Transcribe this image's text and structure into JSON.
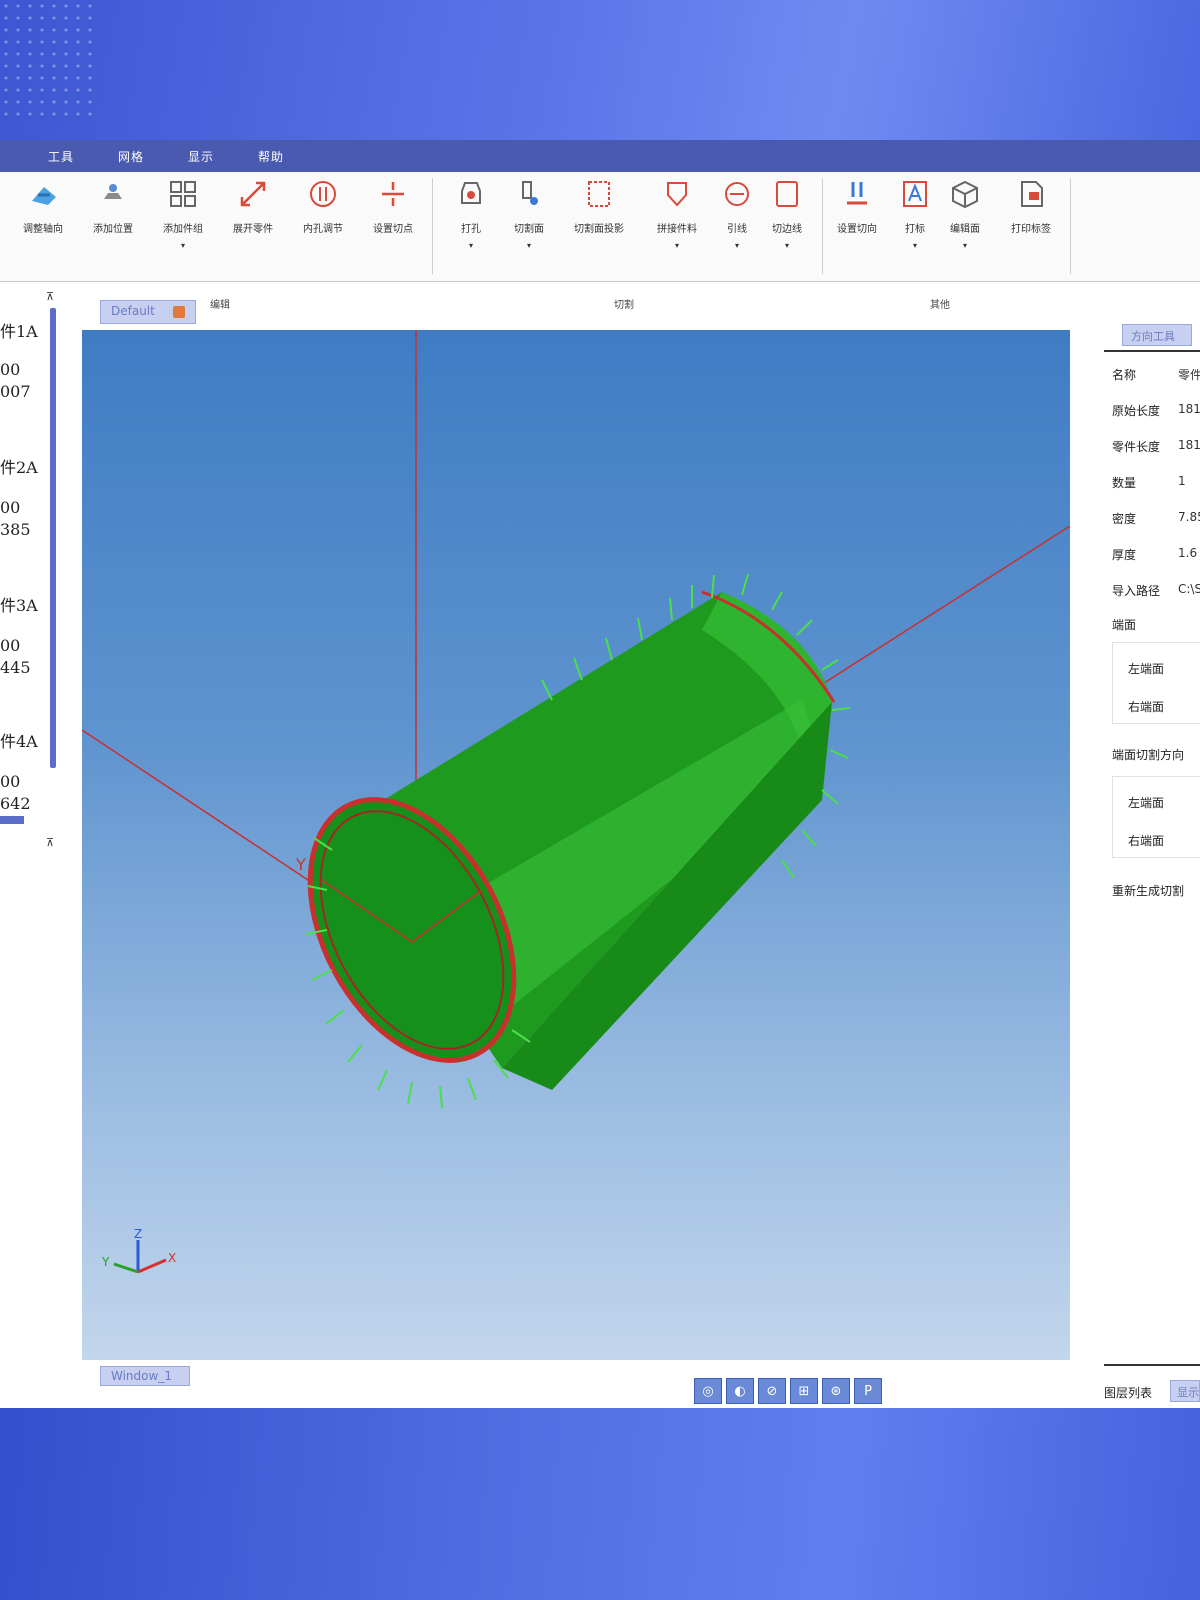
{
  "colors": {
    "menubar": "#4a5ab0",
    "accent": "#5b6dc9",
    "viewport_top": "#3f7cc4",
    "viewport_bottom": "#c2d6ec",
    "model_green": "#1e9a1e",
    "edge_red": "#d12a2a"
  },
  "menu": {
    "items": [
      "工具",
      "网格",
      "显示",
      "帮助"
    ]
  },
  "ribbon": {
    "tools": [
      {
        "label": "调整轴向",
        "icon": "axis-arrow-icon"
      },
      {
        "label": "添加位置",
        "icon": "position-icon"
      },
      {
        "label": "添加件组",
        "icon": "grid-icon"
      },
      {
        "label": "展开零件",
        "icon": "expand-icon"
      },
      {
        "label": "内孔调节",
        "icon": "hole-adjust-icon"
      },
      {
        "label": "设置切点",
        "icon": "cut-point-icon"
      },
      {
        "label": "打孔",
        "icon": "drill-icon"
      },
      {
        "label": "切割面",
        "icon": "cut-face-icon"
      },
      {
        "label": "切割面投影",
        "icon": "projection-icon"
      },
      {
        "label": "拼接件料",
        "icon": "joint-icon"
      },
      {
        "label": "引线",
        "icon": "lead-icon"
      },
      {
        "label": "切边线",
        "icon": "edge-icon"
      },
      {
        "label": "设置切向",
        "icon": "cut-direction-icon"
      },
      {
        "label": "打标",
        "icon": "mark-icon"
      },
      {
        "label": "编辑面",
        "icon": "cube-icon"
      },
      {
        "label": "打印标签",
        "icon": "print-label-icon"
      }
    ],
    "groups": [
      "编辑",
      "切割",
      "其他"
    ]
  },
  "left_panel": {
    "items": [
      {
        "name": "件1A",
        "v1": "00",
        "v2": "007"
      },
      {
        "name": "件2A",
        "v1": "00",
        "v2": "385"
      },
      {
        "name": "件3A",
        "v1": "00",
        "v2": "445"
      },
      {
        "name": "件4A",
        "v1": "00",
        "v2": "642"
      }
    ]
  },
  "tabs": {
    "default": "Default",
    "window": "Window_1"
  },
  "viewport": {
    "axis_label_y": "Y",
    "triad": {
      "x": "X",
      "y": "Y",
      "z": "Z"
    }
  },
  "view_buttons": [
    "◎",
    "◐",
    "⊘",
    "⊞",
    "⊛",
    "P"
  ],
  "right_panel": {
    "tab": "方向工具",
    "rows": [
      {
        "k": "名称",
        "v": "零件"
      },
      {
        "k": "原始长度",
        "v": "181"
      },
      {
        "k": "零件长度",
        "v": "181"
      },
      {
        "k": "数量",
        "v": "1"
      },
      {
        "k": "密度",
        "v": "7.85"
      },
      {
        "k": "厚度",
        "v": "1.6"
      },
      {
        "k": "导入路径",
        "v": "C:\\SK"
      }
    ],
    "section1": "端面",
    "section1_items": [
      "左端面",
      "右端面"
    ],
    "section2": "端面切割方向",
    "section2_items": [
      "左端面",
      "右端面"
    ],
    "regen": "重新生成切割"
  },
  "footer": {
    "label": "图层列表",
    "btn": "显示"
  }
}
